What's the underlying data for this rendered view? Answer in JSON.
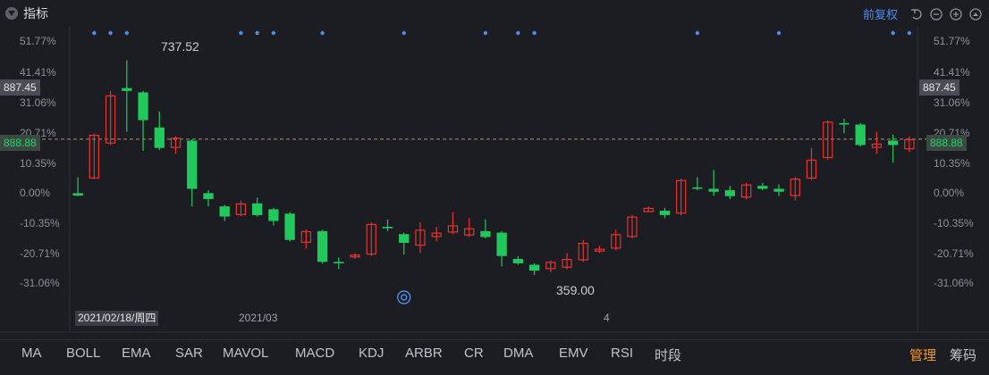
{
  "header": {
    "title": "指标",
    "right_label": "前复权"
  },
  "price_axis": {
    "left_ticks": [
      "51.77%",
      "41.41%",
      "31.06%",
      "20.71%",
      "10.35%",
      "0.00%",
      "-10.35%",
      "-20.71%",
      "-31.06%"
    ],
    "right_ticks": [
      "51.77%",
      "41.41%",
      "31.06%",
      "20.71%",
      "10.35%",
      "0.00%",
      "-10.35%",
      "-20.71%",
      "-31.06%"
    ],
    "crosshair_price": "887.45",
    "reference_price": "888.88"
  },
  "annotations": {
    "high": "737.52",
    "low": "359.00"
  },
  "time_axis": {
    "cursor_date": "2021/02/18/周四",
    "ticks": [
      "2021/03",
      "4"
    ]
  },
  "indicators": [
    "MA",
    "BOLL",
    "EMA",
    "SAR",
    "MAVOL",
    "MACD",
    "KDJ",
    "ARBR",
    "CR",
    "DMA",
    "EMV",
    "RSI",
    "时段"
  ],
  "actions": {
    "manage": "管理",
    "more": "筹码"
  },
  "colors": {
    "up": "#e8322d",
    "down": "#21c95c",
    "background": "#1b1d22",
    "accent": "#4f8ee8"
  },
  "chart_data": {
    "type": "candlestick",
    "y_unit": "%",
    "ylim": [
      -31.06,
      51.77
    ],
    "reference_level": 18.5,
    "candles": [
      {
        "o": 0.0,
        "c": -0.8,
        "h": 5.5,
        "l": -1.0
      },
      {
        "o": 5.0,
        "c": 20.0,
        "h": 20.3,
        "l": 4.8
      },
      {
        "o": 17.0,
        "c": 33.5,
        "h": 35.0,
        "l": 16.5
      },
      {
        "o": 36.0,
        "c": 35.0,
        "h": 45.5,
        "l": 21.0
      },
      {
        "o": 34.5,
        "c": 25.0,
        "h": 35.0,
        "l": 14.5
      },
      {
        "o": 22.5,
        "c": 15.5,
        "h": 28.0,
        "l": 14.8
      },
      {
        "o": 15.5,
        "c": 19.0,
        "h": 19.5,
        "l": 13.5
      },
      {
        "o": 18.0,
        "c": 1.5,
        "h": 18.5,
        "l": -4.5
      },
      {
        "o": 0.0,
        "c": -2.0,
        "h": 1.0,
        "l": -4.5
      },
      {
        "o": -4.5,
        "c": -8.0,
        "h": -4.0,
        "l": -9.5
      },
      {
        "o": -7.5,
        "c": -3.5,
        "h": -2.5,
        "l": -7.8
      },
      {
        "o": -3.5,
        "c": -7.5,
        "h": -1.5,
        "l": -8.0
      },
      {
        "o": -5.5,
        "c": -9.5,
        "h": -5.0,
        "l": -11.0
      },
      {
        "o": -7.0,
        "c": -16.0,
        "h": -6.5,
        "l": -16.5
      },
      {
        "o": -17.0,
        "c": -13.0,
        "h": -12.5,
        "l": -19.0
      },
      {
        "o": -13.0,
        "c": -23.5,
        "h": -12.5,
        "l": -24.0
      },
      {
        "o": -23.5,
        "c": -24.0,
        "h": -22.0,
        "l": -26.0
      },
      {
        "o": -22.0,
        "c": -21.0,
        "h": -20.5,
        "l": -22.5
      },
      {
        "o": -21.0,
        "c": -10.5,
        "h": -10.0,
        "l": -21.5
      },
      {
        "o": -11.5,
        "c": -12.0,
        "h": -9.0,
        "l": -13.0
      },
      {
        "o": -14.0,
        "c": -17.0,
        "h": -13.5,
        "l": -21.0
      },
      {
        "o": -18.0,
        "c": -12.5,
        "h": -10.0,
        "l": -20.5
      },
      {
        "o": -15.0,
        "c": -13.5,
        "h": -11.5,
        "l": -16.5
      },
      {
        "o": -13.5,
        "c": -11.0,
        "h": -6.5,
        "l": -14.0
      },
      {
        "o": -14.5,
        "c": -12.0,
        "h": -8.5,
        "l": -15.0
      },
      {
        "o": -13.0,
        "c": -15.0,
        "h": -9.0,
        "l": -15.5
      },
      {
        "o": -13.5,
        "c": -21.5,
        "h": -13.0,
        "l": -25.0
      },
      {
        "o": -22.5,
        "c": -24.0,
        "h": -21.5,
        "l": -24.5
      },
      {
        "o": -24.5,
        "c": -26.5,
        "h": -24.0,
        "l": -28.0
      },
      {
        "o": -26.0,
        "c": -23.5,
        "h": -23.0,
        "l": -27.0
      },
      {
        "o": -25.5,
        "c": -22.5,
        "h": -20.5,
        "l": -26.0
      },
      {
        "o": -23.0,
        "c": -17.0,
        "h": -16.0,
        "l": -23.5
      },
      {
        "o": -20.0,
        "c": -19.0,
        "h": -18.0,
        "l": -20.5
      },
      {
        "o": -19.0,
        "c": -14.0,
        "h": -12.5,
        "l": -19.5
      },
      {
        "o": -15.0,
        "c": -8.0,
        "h": -7.5,
        "l": -15.5
      },
      {
        "o": -6.5,
        "c": -5.0,
        "h": -4.5,
        "l": -6.5
      },
      {
        "o": -6.0,
        "c": -7.5,
        "h": -5.0,
        "l": -8.5
      },
      {
        "o": -7.0,
        "c": 4.5,
        "h": 5.0,
        "l": -7.5
      },
      {
        "o": 2.0,
        "c": 1.5,
        "h": 5.5,
        "l": 1.0
      },
      {
        "o": 1.5,
        "c": 0.5,
        "h": 8.0,
        "l": -1.0
      },
      {
        "o": 1.0,
        "c": -1.0,
        "h": 2.5,
        "l": -2.0
      },
      {
        "o": -1.5,
        "c": 3.0,
        "h": 3.5,
        "l": -2.0
      },
      {
        "o": 2.5,
        "c": 1.5,
        "h": 3.5,
        "l": 1.0
      },
      {
        "o": 1.5,
        "c": 0.5,
        "h": 3.0,
        "l": -1.0
      },
      {
        "o": -1.0,
        "c": 5.0,
        "h": 5.5,
        "l": -2.5
      },
      {
        "o": 5.0,
        "c": 11.5,
        "h": 15.5,
        "l": 4.5
      },
      {
        "o": 12.0,
        "c": 24.5,
        "h": 25.0,
        "l": 11.5
      },
      {
        "o": 24.0,
        "c": 23.5,
        "h": 25.5,
        "l": 20.5
      },
      {
        "o": 23.5,
        "c": 16.5,
        "h": 24.0,
        "l": 16.0
      },
      {
        "o": 15.5,
        "c": 17.0,
        "h": 21.0,
        "l": 13.5
      },
      {
        "o": 18.0,
        "c": 16.5,
        "h": 20.0,
        "l": 10.5
      },
      {
        "o": 15.0,
        "c": 18.5,
        "h": 19.5,
        "l": 14.0
      }
    ],
    "event_marker_indices": [
      1,
      2,
      3,
      10,
      11,
      12,
      15,
      20,
      25,
      27,
      28,
      38,
      43,
      50,
      51
    ]
  }
}
